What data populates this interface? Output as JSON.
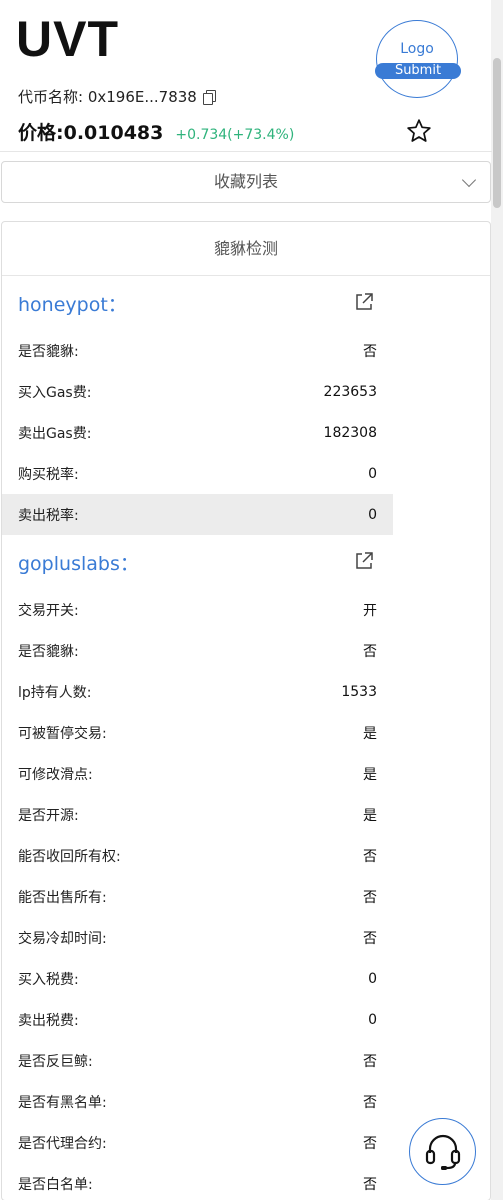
{
  "header": {
    "token": "UVT",
    "contract_label": "代币名称: 0x196E...7838",
    "price_label": "价格:0.010483",
    "price_change": "+0.734(+73.4%)",
    "logo_text": "Logo",
    "submit_label": "Submit"
  },
  "collect": {
    "label": "收藏列表"
  },
  "panel": {
    "title": "貔貅检测",
    "honeypot": {
      "name": "honeypot：",
      "rows": [
        {
          "label": "是否貔貅:",
          "value": "否"
        },
        {
          "label": "买入Gas费:",
          "value": "223653"
        },
        {
          "label": "卖出Gas费:",
          "value": "182308"
        },
        {
          "label": "购买税率:",
          "value": "0"
        },
        {
          "label": "卖出税率:",
          "value": "0"
        }
      ]
    },
    "gopluslabs": {
      "name": "gopluslabs：",
      "rows": [
        {
          "label": "交易开关:",
          "value": "开"
        },
        {
          "label": "是否貔貅:",
          "value": "否"
        },
        {
          "label": "lp持有人数:",
          "value": "1533"
        },
        {
          "label": "可被暂停交易:",
          "value": "是"
        },
        {
          "label": "可修改滑点:",
          "value": "是"
        },
        {
          "label": "是否开源:",
          "value": "是"
        },
        {
          "label": "能否收回所有权:",
          "value": "否"
        },
        {
          "label": "能否出售所有:",
          "value": "否"
        },
        {
          "label": "交易冷却时间:",
          "value": "否"
        },
        {
          "label": "买入税费:",
          "value": "0"
        },
        {
          "label": "卖出税费:",
          "value": "0"
        },
        {
          "label": "是否反巨鲸:",
          "value": "否"
        },
        {
          "label": "是否有黑名单:",
          "value": "否"
        },
        {
          "label": "是否代理合约:",
          "value": "否"
        },
        {
          "label": "是否白名单:",
          "value": "否"
        }
      ]
    }
  },
  "colors": {
    "accent": "#3a7bd5",
    "up": "#2fb37c",
    "highlight_row": "#ececec"
  },
  "icons": [
    "copy-icon",
    "star-icon",
    "chevron-down-icon",
    "external-link-icon",
    "headset-icon"
  ]
}
